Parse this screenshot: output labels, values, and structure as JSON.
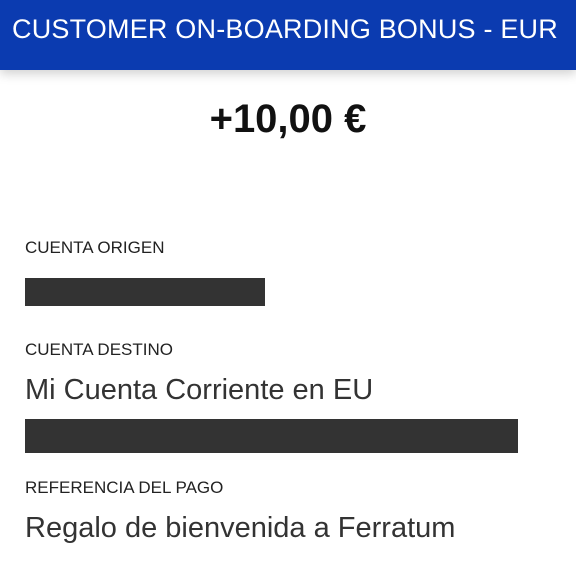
{
  "header": {
    "title": "CUSTOMER ON-BOARDING BONUS - EUR",
    "background_color": "#0b3bb0"
  },
  "transaction": {
    "amount": "+10,00 €"
  },
  "fields": {
    "source_account_label": "CUENTA ORIGEN",
    "destination_account_label": "CUENTA DESTINO",
    "destination_account_name": "Mi Cuenta Corriente en EU",
    "payment_reference_label": "REFERENCIA DEL PAGO",
    "payment_reference_value": "Regalo de bienvenida a Ferratum"
  },
  "colors": {
    "redaction": "#333333"
  }
}
